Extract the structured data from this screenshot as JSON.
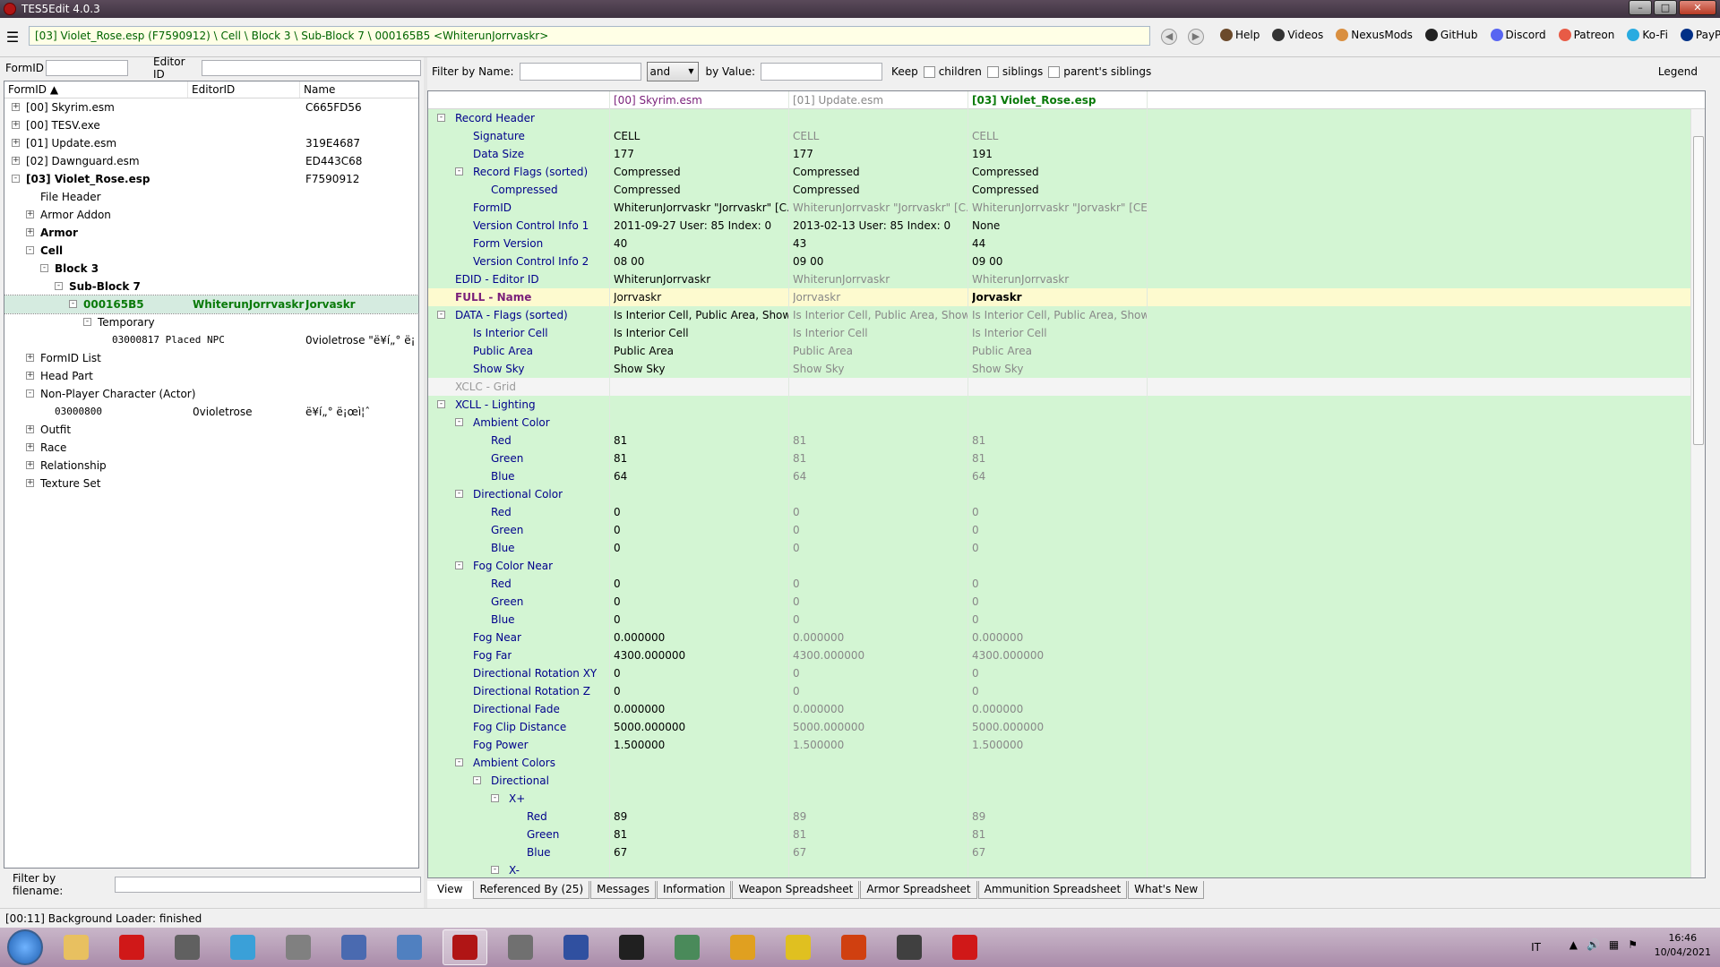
{
  "window": {
    "title": "TES5Edit 4.0.3"
  },
  "toolbar": {
    "path": "[03] Violet_Rose.esp (F7590912) \\ Cell \\ Block 3 \\ Sub-Block 7 \\ 000165B5 <WhiterunJorrvaskr>",
    "links": [
      {
        "icon": "book-icon",
        "label": "Help",
        "color": "#6b4a2b"
      },
      {
        "icon": "video-icon",
        "label": "Videos",
        "color": "#333333"
      },
      {
        "icon": "nexusmods-icon",
        "label": "NexusMods",
        "color": "#d98f40"
      },
      {
        "icon": "github-icon",
        "label": "GitHub",
        "color": "#222222"
      },
      {
        "icon": "discord-icon",
        "label": "Discord",
        "color": "#5865f2"
      },
      {
        "icon": "patreon-icon",
        "label": "Patreon",
        "color": "#e85b46"
      },
      {
        "icon": "kofi-icon",
        "label": "Ko-Fi",
        "color": "#29abe0"
      },
      {
        "icon": "paypal-icon",
        "label": "PayPal",
        "color": "#003087"
      }
    ]
  },
  "left": {
    "formid_label": "FormID",
    "editorid_label": "Editor ID",
    "columns": [
      "FormID",
      "EditorID",
      "Name"
    ],
    "filter_filename_label": "Filter by filename:",
    "tree": [
      {
        "indent": 0,
        "exp": "+",
        "c0": "[00] Skyrim.esm",
        "c1": "",
        "c2": "C665FD56",
        "bold": false
      },
      {
        "indent": 0,
        "exp": "+",
        "c0": "[00] TESV.exe",
        "c1": "",
        "c2": "",
        "bold": false
      },
      {
        "indent": 0,
        "exp": "+",
        "c0": "[01] Update.esm",
        "c1": "",
        "c2": "319E4687",
        "bold": false
      },
      {
        "indent": 0,
        "exp": "+",
        "c0": "[02] Dawnguard.esm",
        "c1": "",
        "c2": "ED443C68",
        "bold": false
      },
      {
        "indent": 0,
        "exp": "-",
        "c0": "[03] Violet_Rose.esp",
        "c1": "",
        "c2": "F7590912",
        "bold": true
      },
      {
        "indent": 1,
        "exp": "",
        "c0": "File Header",
        "c1": "",
        "c2": "",
        "bold": false
      },
      {
        "indent": 1,
        "exp": "+",
        "c0": "Armor Addon",
        "c1": "",
        "c2": "",
        "bold": false
      },
      {
        "indent": 1,
        "exp": "+",
        "c0": "Armor",
        "c1": "",
        "c2": "",
        "bold": true
      },
      {
        "indent": 1,
        "exp": "-",
        "c0": "Cell",
        "c1": "",
        "c2": "",
        "bold": true
      },
      {
        "indent": 2,
        "exp": "-",
        "c0": "Block 3",
        "c1": "",
        "c2": "",
        "bold": true
      },
      {
        "indent": 3,
        "exp": "-",
        "c0": "Sub-Block 7",
        "c1": "",
        "c2": "",
        "bold": true
      },
      {
        "indent": 4,
        "exp": "-",
        "c0": "000165B5",
        "c1": "WhiterunJorrvaskr",
        "c2": "Jorvaskr",
        "bold": true,
        "selected": true
      },
      {
        "indent": 5,
        "exp": "-",
        "c0": "Temporary",
        "c1": "",
        "c2": "",
        "bold": false
      },
      {
        "indent": 6,
        "exp": "",
        "c0": "03000817 Placed NPC",
        "c1": "",
        "c2": "0violetrose \"ë¥í„° ë¡...",
        "bold": false,
        "mono": true
      },
      {
        "indent": 1,
        "exp": "+",
        "c0": "FormID List",
        "c1": "",
        "c2": "",
        "bold": false
      },
      {
        "indent": 1,
        "exp": "+",
        "c0": "Head Part",
        "c1": "",
        "c2": "",
        "bold": false
      },
      {
        "indent": 1,
        "exp": "-",
        "c0": "Non-Player Character (Actor)",
        "c1": "",
        "c2": "",
        "bold": false
      },
      {
        "indent": 2,
        "exp": "",
        "c0": "03000800",
        "c1": "0violetrose",
        "c2": "ë¥í„° ë¡œì¦ˆ",
        "bold": false,
        "mono": true
      },
      {
        "indent": 1,
        "exp": "+",
        "c0": "Outfit",
        "c1": "",
        "c2": "",
        "bold": false
      },
      {
        "indent": 1,
        "exp": "+",
        "c0": "Race",
        "c1": "",
        "c2": "",
        "bold": false
      },
      {
        "indent": 1,
        "exp": "+",
        "c0": "Relationship",
        "c1": "",
        "c2": "",
        "bold": false
      },
      {
        "indent": 1,
        "exp": "+",
        "c0": "Texture Set",
        "c1": "",
        "c2": "",
        "bold": false
      }
    ]
  },
  "right": {
    "filter_name_label": "Filter by Name:",
    "operator": "and",
    "filter_value_label": "by Value:",
    "keep_label": "Keep",
    "children_label": "children",
    "siblings_label": "siblings",
    "parents_label": "parent's siblings",
    "legend_label": "Legend",
    "columns": [
      "[00] Skyrim.esm",
      "[01] Update.esm",
      "[03] Violet_Rose.esp"
    ],
    "rows": [
      {
        "lvl": 0,
        "exp": "-",
        "label": "Record Header",
        "v": [
          "",
          "",
          ""
        ]
      },
      {
        "lvl": 1,
        "exp": "",
        "label": "Signature",
        "v": [
          "CELL",
          "CELL",
          "CELL"
        ]
      },
      {
        "lvl": 1,
        "exp": "",
        "label": "Data Size",
        "v": [
          "177",
          "177",
          "191"
        ],
        "v3dark": true,
        "v2dark": true
      },
      {
        "lvl": 1,
        "exp": "-",
        "label": "Record Flags (sorted)",
        "v": [
          "Compressed",
          "Compressed",
          "Compressed"
        ],
        "v3dark": true,
        "v2dark": true
      },
      {
        "lvl": 2,
        "exp": "",
        "label": "Compressed",
        "v": [
          "Compressed",
          "Compressed",
          "Compressed"
        ],
        "v3dark": true,
        "v2dark": true
      },
      {
        "lvl": 1,
        "exp": "",
        "label": "FormID",
        "v": [
          "WhiterunJorrvaskr \"Jorrvaskr\" [C...",
          "WhiterunJorrvaskr \"Jorrvaskr\" [C...",
          "WhiterunJorrvaskr \"Jorvaskr\" [CE..."
        ]
      },
      {
        "lvl": 1,
        "exp": "",
        "label": "Version Control Info 1",
        "v": [
          "2011-09-27 User: 85 Index: 0",
          "2013-02-13 User: 85 Index: 0",
          "None"
        ],
        "v3dark": true,
        "v2dark": true
      },
      {
        "lvl": 1,
        "exp": "",
        "label": "Form Version",
        "v": [
          "40",
          "43",
          "44"
        ],
        "v3dark": true,
        "v2dark": true
      },
      {
        "lvl": 1,
        "exp": "",
        "label": "Version Control Info 2",
        "v": [
          "08 00",
          "09 00",
          "09 00"
        ],
        "v3dark": true,
        "v2dark": true
      },
      {
        "lvl": 0,
        "exp": "",
        "label": "EDID - Editor ID",
        "v": [
          "WhiterunJorrvaskr",
          "WhiterunJorrvaskr",
          "WhiterunJorrvaskr"
        ]
      },
      {
        "lvl": 0,
        "exp": "",
        "label": "FULL - Name",
        "v": [
          "Jorrvaskr",
          "Jorrvaskr",
          "Jorvaskr"
        ],
        "yellow": true,
        "boldlabel": true,
        "v3bold": true
      },
      {
        "lvl": 0,
        "exp": "-",
        "label": "DATA - Flags (sorted)",
        "v": [
          "Is Interior Cell, Public Area, Show...",
          "Is Interior Cell, Public Area, Show...",
          "Is Interior Cell, Public Area, Show..."
        ]
      },
      {
        "lvl": 1,
        "exp": "",
        "label": "Is Interior Cell",
        "v": [
          "Is Interior Cell",
          "Is Interior Cell",
          "Is Interior Cell"
        ]
      },
      {
        "lvl": 1,
        "exp": "",
        "label": "Public Area",
        "v": [
          "Public Area",
          "Public Area",
          "Public Area"
        ]
      },
      {
        "lvl": 1,
        "exp": "",
        "label": "Show Sky",
        "v": [
          "Show Sky",
          "Show Sky",
          "Show Sky"
        ]
      },
      {
        "lvl": 0,
        "exp": "",
        "label": "XCLC - Grid",
        "v": [
          "",
          "",
          ""
        ],
        "grey": true
      },
      {
        "lvl": 0,
        "exp": "-",
        "label": "XCLL - Lighting",
        "v": [
          "",
          "",
          ""
        ]
      },
      {
        "lvl": 1,
        "exp": "-",
        "label": "Ambient Color",
        "v": [
          "",
          "",
          ""
        ]
      },
      {
        "lvl": 2,
        "exp": "",
        "label": "Red",
        "v": [
          "81",
          "81",
          "81"
        ]
      },
      {
        "lvl": 2,
        "exp": "",
        "label": "Green",
        "v": [
          "81",
          "81",
          "81"
        ]
      },
      {
        "lvl": 2,
        "exp": "",
        "label": "Blue",
        "v": [
          "64",
          "64",
          "64"
        ]
      },
      {
        "lvl": 1,
        "exp": "-",
        "label": "Directional Color",
        "v": [
          "",
          "",
          ""
        ]
      },
      {
        "lvl": 2,
        "exp": "",
        "label": "Red",
        "v": [
          "0",
          "0",
          "0"
        ]
      },
      {
        "lvl": 2,
        "exp": "",
        "label": "Green",
        "v": [
          "0",
          "0",
          "0"
        ]
      },
      {
        "lvl": 2,
        "exp": "",
        "label": "Blue",
        "v": [
          "0",
          "0",
          "0"
        ]
      },
      {
        "lvl": 1,
        "exp": "-",
        "label": "Fog Color Near",
        "v": [
          "",
          "",
          ""
        ]
      },
      {
        "lvl": 2,
        "exp": "",
        "label": "Red",
        "v": [
          "0",
          "0",
          "0"
        ]
      },
      {
        "lvl": 2,
        "exp": "",
        "label": "Green",
        "v": [
          "0",
          "0",
          "0"
        ]
      },
      {
        "lvl": 2,
        "exp": "",
        "label": "Blue",
        "v": [
          "0",
          "0",
          "0"
        ]
      },
      {
        "lvl": 1,
        "exp": "",
        "label": "Fog Near",
        "v": [
          "0.000000",
          "0.000000",
          "0.000000"
        ]
      },
      {
        "lvl": 1,
        "exp": "",
        "label": "Fog Far",
        "v": [
          "4300.000000",
          "4300.000000",
          "4300.000000"
        ]
      },
      {
        "lvl": 1,
        "exp": "",
        "label": "Directional Rotation XY",
        "v": [
          "0",
          "0",
          "0"
        ]
      },
      {
        "lvl": 1,
        "exp": "",
        "label": "Directional Rotation Z",
        "v": [
          "0",
          "0",
          "0"
        ]
      },
      {
        "lvl": 1,
        "exp": "",
        "label": "Directional Fade",
        "v": [
          "0.000000",
          "0.000000",
          "0.000000"
        ]
      },
      {
        "lvl": 1,
        "exp": "",
        "label": "Fog Clip Distance",
        "v": [
          "5000.000000",
          "5000.000000",
          "5000.000000"
        ]
      },
      {
        "lvl": 1,
        "exp": "",
        "label": "Fog Power",
        "v": [
          "1.500000",
          "1.500000",
          "1.500000"
        ]
      },
      {
        "lvl": 1,
        "exp": "-",
        "label": "Ambient Colors",
        "v": [
          "",
          "",
          ""
        ]
      },
      {
        "lvl": 2,
        "exp": "-",
        "label": "Directional",
        "v": [
          "",
          "",
          ""
        ]
      },
      {
        "lvl": 3,
        "exp": "-",
        "label": "X+",
        "v": [
          "",
          "",
          ""
        ]
      },
      {
        "lvl": 4,
        "exp": "",
        "label": "Red",
        "v": [
          "89",
          "89",
          "89"
        ]
      },
      {
        "lvl": 4,
        "exp": "",
        "label": "Green",
        "v": [
          "81",
          "81",
          "81"
        ]
      },
      {
        "lvl": 4,
        "exp": "",
        "label": "Blue",
        "v": [
          "67",
          "67",
          "67"
        ]
      },
      {
        "lvl": 3,
        "exp": "-",
        "label": "X-",
        "v": [
          "",
          "",
          ""
        ]
      }
    ],
    "tabs": [
      "View",
      "Referenced By (25)",
      "Messages",
      "Information",
      "Weapon Spreadsheet",
      "Armor Spreadsheet",
      "Ammunition Spreadsheet",
      "What's New"
    ]
  },
  "status": {
    "text": "[00:11] Background Loader: finished"
  },
  "taskbar": {
    "apps": [
      {
        "icon": "explorer-icon",
        "color": "#e8c060"
      },
      {
        "icon": "opera-icon",
        "color": "#d01818"
      },
      {
        "icon": "media-icon",
        "color": "#606060"
      },
      {
        "icon": "music-icon",
        "color": "#3aa0d8"
      },
      {
        "icon": "speaker-icon",
        "color": "#808080"
      },
      {
        "icon": "ffdec-icon",
        "color": "#4a6ab0"
      },
      {
        "icon": "pen-icon",
        "color": "#5080c0"
      },
      {
        "icon": "tes5edit-icon",
        "color": "#b01515",
        "active": true
      },
      {
        "icon": "people-icon",
        "color": "#707070"
      },
      {
        "icon": "headphones-icon",
        "color": "#3050a0"
      },
      {
        "icon": "mod-manager-icon",
        "color": "#202020"
      },
      {
        "icon": "window-icon",
        "color": "#4a8a5a"
      },
      {
        "icon": "bolt-icon",
        "color": "#e0a020"
      },
      {
        "icon": "folder-icon",
        "color": "#e0c020"
      },
      {
        "icon": "fallout-icon",
        "color": "#d04010"
      },
      {
        "icon": "creation-kit-icon",
        "color": "#404040"
      },
      {
        "icon": "opera-icon",
        "color": "#d01818"
      }
    ],
    "lang": "IT",
    "time": "16:46",
    "date": "10/04/2021"
  }
}
